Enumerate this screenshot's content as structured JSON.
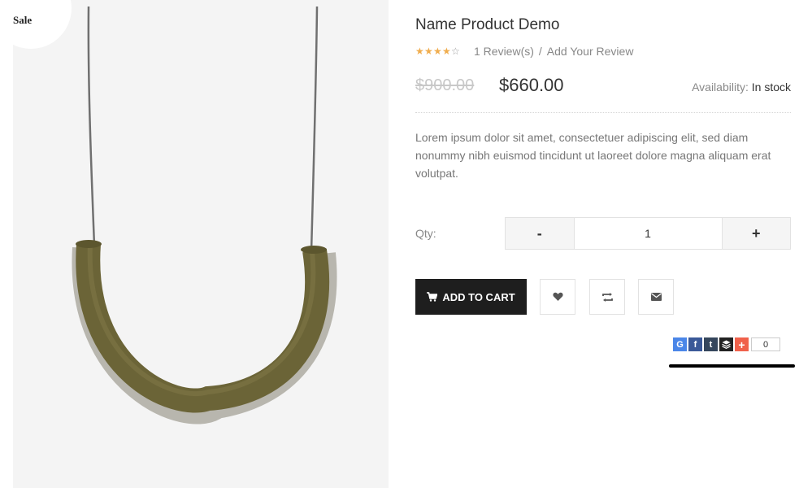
{
  "badge": {
    "sale": "Sale"
  },
  "product": {
    "title": "Name Product Demo",
    "rating": {
      "value": 4,
      "max": 5,
      "reviews_label": "1 Review(s)",
      "separator": "/",
      "add_review_label": "Add Your Review"
    },
    "old_price": "$900.00",
    "price": "$660.00",
    "availability_label": "Availability:",
    "availability_value": "In stock",
    "description": "Lorem ipsum dolor sit amet, consectetuer adipiscing elit, sed diam nonummy nibh euismod tincidunt ut laoreet dolore magna aliquam erat volutpat."
  },
  "quantity": {
    "label": "Qty:",
    "value": "1",
    "minus": "-",
    "plus": "+"
  },
  "actions": {
    "add_to_cart": "ADD TO CART"
  },
  "share": {
    "count": "0"
  },
  "colors": {
    "star": "#f0ad4e",
    "cart_bg": "#1e1e1e",
    "image_bg": "#f4f4f4",
    "necklace": "#6b6437"
  },
  "icons": [
    "cart-icon",
    "heart-icon",
    "compare-icon",
    "envelope-icon",
    "google-icon",
    "facebook-icon",
    "tumblr-icon",
    "buffer-icon",
    "plus-icon"
  ]
}
